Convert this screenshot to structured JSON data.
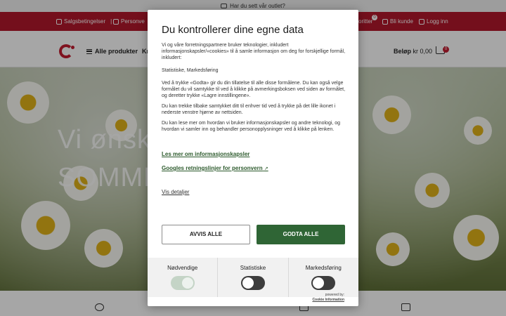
{
  "topbar": {
    "text": "Har du sett vår outlet?"
  },
  "utility_bar": {
    "terms": "Salgsbetingelser",
    "divider": "|",
    "personal_partial": "Personve",
    "favorites_partial": "oritter",
    "favorites_count": "0",
    "become_customer": "Bli kunde",
    "login": "Logg inn"
  },
  "header": {
    "all_products": "Alle produkter",
    "category_partial": "Kr",
    "balance_label": "Beløp",
    "balance_value": "kr 0,00",
    "cart_count": "0"
  },
  "hero": {
    "line1": "Vi ønsk",
    "line2": "SOMME"
  },
  "consent": {
    "title": "Du kontrollerer dine egne data",
    "paragraph1": "Vi og våre forretningspartnere bruker teknologier, inkludert informasjonskapsler/«cookies» til å samle informasjon om deg for forskjellige formål, inkludert:",
    "purposes": "Statistiske, Markedsføring",
    "paragraph2": "Ved å trykke «Godta» gir du din tillatelse til alle disse formålene. Du kan også velge formålet du vil samtykke til ved å klikke på avmerkingsboksen ved siden av formålet, og deretter trykke «Lagre innstillingene».",
    "paragraph3": "Du kan trekke tilbake samtykket ditt til enhver tid ved å trykke på det lille ikonet i nederste venstre hjørne av nettsiden.",
    "paragraph4": "Du kan lese mer om hvordan vi bruker informasjonskapsler og andre teknologi, og hvordan vi samler inn og behandler personopplysninger ved å klikke på lenken.",
    "link_cookies": "Les mer om informasjonskapsler",
    "link_google": "Googles retningslinjer for personvern",
    "link_details": "Vis detaljer",
    "reject_label": "AVVIS ALLE",
    "accept_label": "GODTA ALLE",
    "toggles": [
      {
        "label": "Nødvendige",
        "state": "on (disabled)"
      },
      {
        "label": "Statistiske",
        "state": "off"
      },
      {
        "label": "Markedsføring",
        "state": "off"
      }
    ],
    "powered_by": "powered by:",
    "powered_brand": "Cookie Information"
  },
  "colors": {
    "utility_bar": "#b3182b",
    "accept_button": "#2f6535",
    "toggle_off": "#3d3d3d",
    "toggle_on_disabled": "#c4d4c6"
  }
}
